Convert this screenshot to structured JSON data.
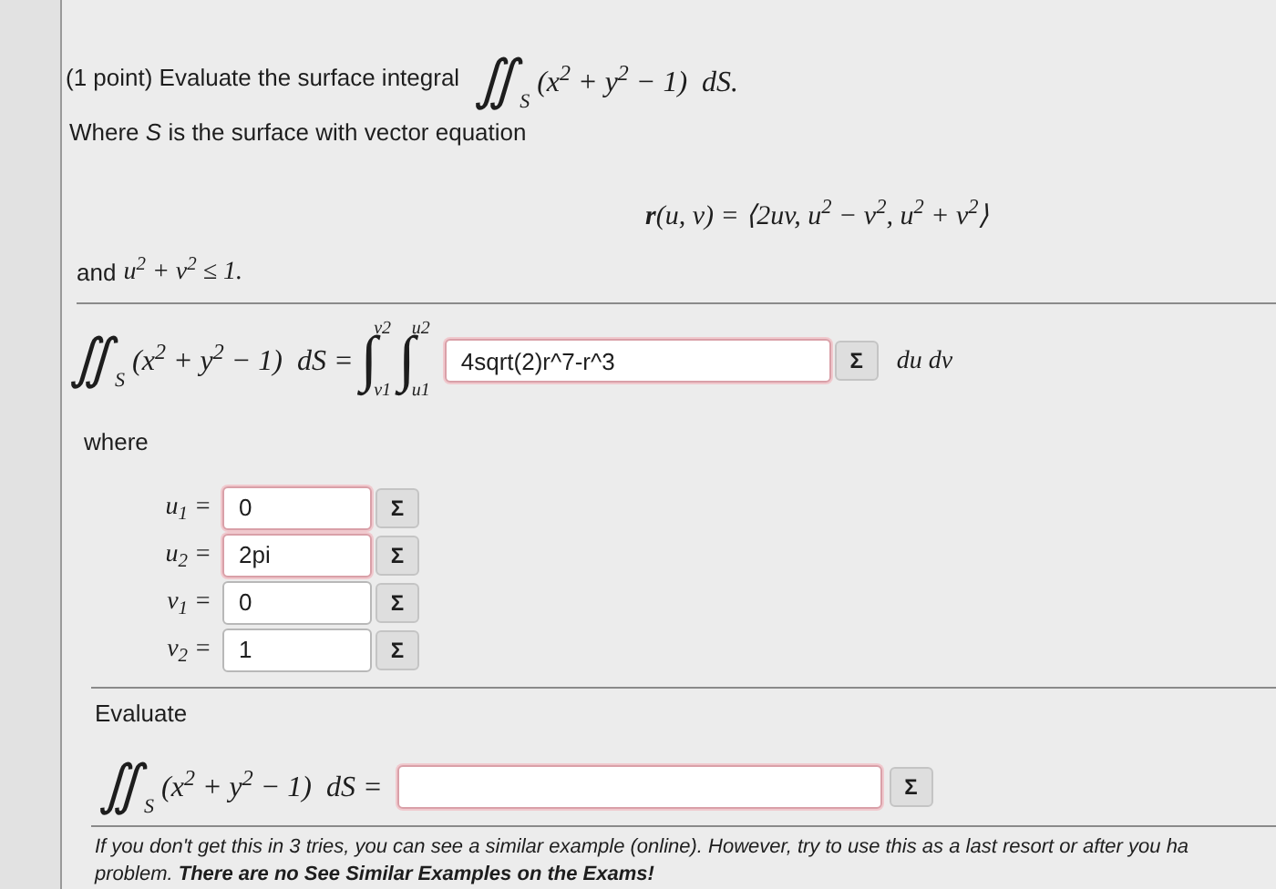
{
  "header": {
    "lead": "(1 point) Evaluate the surface integral",
    "integral": {
      "sign": "∬",
      "domain": "S",
      "integrand": "(x$^{2}$ + y$^{2}$ − 1)  dS."
    }
  },
  "surface_text": "Where *S* is the surface with vector equation",
  "vector_equation": "**r**(u, v) = ⟨2uv, u$^{2}$ − v$^{2}$, u$^{2}$ + v$^{2}$⟩",
  "constraint_lead": "and",
  "constraint": "u$^{2}$ + v$^{2}$ ≤ 1.",
  "setup": {
    "integral": {
      "sign": "∬",
      "domain": "S",
      "integrand": "(x$^{2}$ + y$^{2}$ − 1)  dS ="
    },
    "outer": {
      "sign": "∫",
      "upper": "v2",
      "lower": "v1"
    },
    "inner": {
      "sign": "∫",
      "upper": "u2",
      "lower": "u1"
    },
    "answer": {
      "value": "4sqrt(2)r^7-r^3",
      "incorrect": true
    },
    "equation_button": "Σ",
    "differentials": "du dv"
  },
  "where_label": "where",
  "limits": [
    {
      "variable": "u$_{1}$ =",
      "value": "0",
      "incorrect": true,
      "equation_button": "Σ"
    },
    {
      "variable": "u$_{2}$ =",
      "value": "2pi",
      "incorrect": true,
      "equation_button": "Σ"
    },
    {
      "variable": "v$_{1}$ =",
      "value": "0",
      "incorrect": false,
      "equation_button": "Σ"
    },
    {
      "variable": "v$_{2}$ =",
      "value": "1",
      "incorrect": false,
      "equation_button": "Σ"
    }
  ],
  "evaluate_label": "Evaluate",
  "final": {
    "integral": {
      "sign": "∬",
      "domain": "S",
      "integrand": "(x$^{2}$ + y$^{2}$ − 1)  dS ="
    },
    "answer": {
      "incorrect": true
    },
    "equation_button": "Σ"
  },
  "footer_lines": [
    "If you don't get this in 3 tries, you can see a similar example (online). However, try to use this as a last resort or after you ha",
    "problem. **There are no See Similar Examples on the Exams!**"
  ]
}
